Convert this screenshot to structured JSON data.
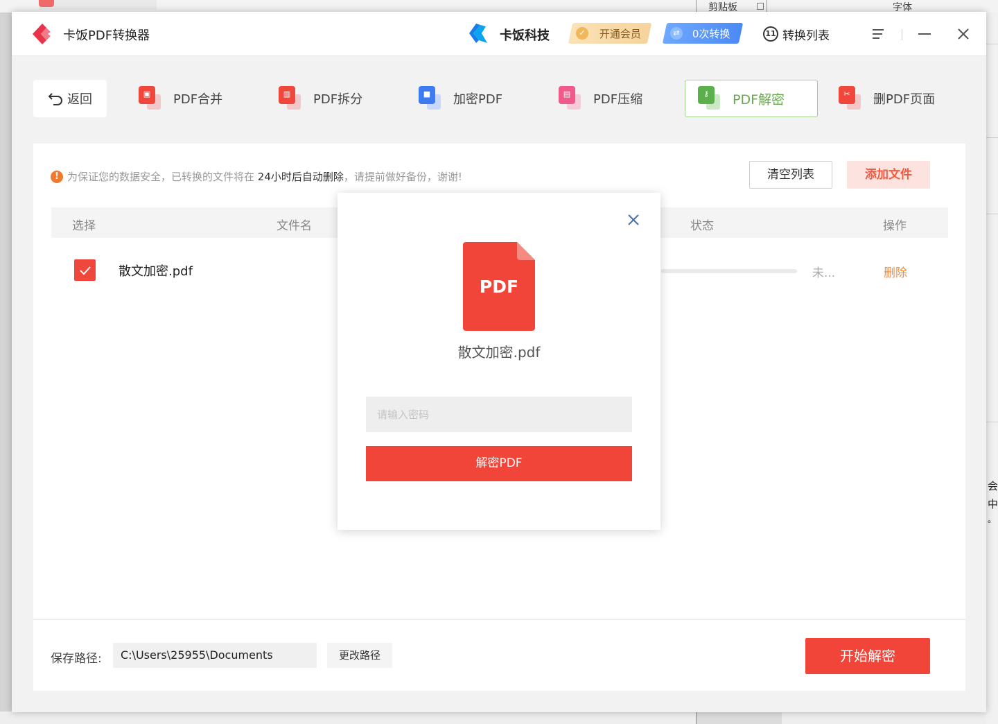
{
  "background": {
    "top_clipboard": "剪贴板",
    "top_font": "字体",
    "right_chars": [
      "会",
      "中",
      "。"
    ]
  },
  "titlebar": {
    "app_title": "卡饭PDF转换器",
    "brand_name": "卡饭科技",
    "vip_label": "开通会员",
    "conversion_label": "0次转换",
    "conversion_list_label": "转换列表",
    "conversion_list_icon_text": "11"
  },
  "toolbar": {
    "back_label": "返回",
    "tools": [
      {
        "label": "PDF合并",
        "color": "#f0473d",
        "active": false
      },
      {
        "label": "PDF拆分",
        "color": "#f0473d",
        "active": false
      },
      {
        "label": "加密PDF",
        "color": "#3d7cf0",
        "active": false
      },
      {
        "label": "PDF压缩",
        "color": "#ef5a8a",
        "active": false
      },
      {
        "label": "PDF解密",
        "color": "#5cb04c",
        "active": true
      },
      {
        "label": "删PDF页面",
        "color": "#f0473d",
        "active": false
      }
    ]
  },
  "notice": {
    "part1": "为保证您的数据安全，已转换的文件将在 ",
    "highlight": "24小时后自动删除",
    "part2": "，请提前做好备份，谢谢!"
  },
  "actions": {
    "clear_list": "清空列表",
    "add_file": "添加文件"
  },
  "table": {
    "headers": {
      "select": "选择",
      "filename": "文件名",
      "status": "状态",
      "operation": "操作"
    },
    "rows": [
      {
        "checked": true,
        "filename": "散文加密.pdf",
        "status": "未...",
        "action": "删除"
      }
    ]
  },
  "bottom": {
    "save_path_label": "保存路径:",
    "save_path": "C:\\Users\\25955\\Documents",
    "change_path": "更改路径",
    "start_button": "开始解密"
  },
  "modal": {
    "icon_text": "PDF",
    "filename": "散文加密.pdf",
    "password_placeholder": "请输入密码",
    "password_value": "",
    "decrypt_button": "解密PDF"
  },
  "colors": {
    "accent_red": "#f2453a",
    "active_green": "#6aa84f",
    "warning_orange": "#f27a2e"
  }
}
